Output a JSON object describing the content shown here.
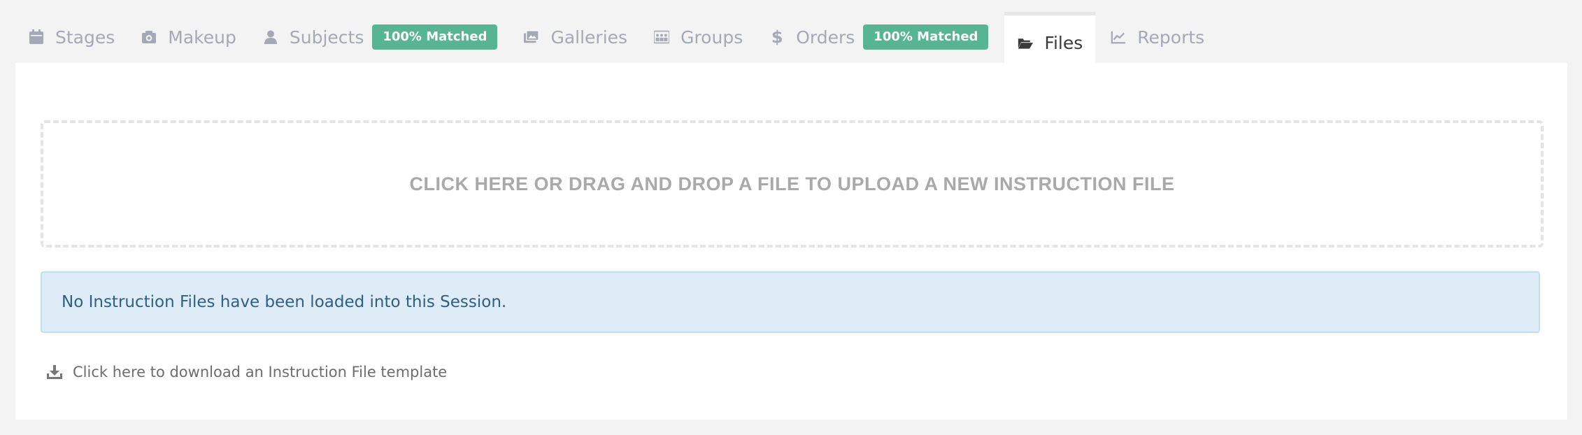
{
  "tabs": [
    {
      "label": "Stages",
      "icon": "calendar-icon"
    },
    {
      "label": "Makeup",
      "icon": "camera-icon"
    },
    {
      "label": "Subjects",
      "icon": "user-icon",
      "badge": "100% Matched"
    },
    {
      "label": "Galleries",
      "icon": "image-icon"
    },
    {
      "label": "Groups",
      "icon": "group-icon"
    },
    {
      "label": "Orders",
      "icon": "dollar-icon",
      "badge": "100% Matched"
    },
    {
      "label": "Files",
      "icon": "folder-open-icon",
      "active": true
    },
    {
      "label": "Reports",
      "icon": "chart-line-icon"
    }
  ],
  "upload": {
    "text": "CLICK HERE OR DRAG AND DROP A FILE TO UPLOAD A NEW INSTRUCTION FILE"
  },
  "alert": {
    "text": "No Instruction Files have been loaded into this Session."
  },
  "download": {
    "text": "Click here to download an Instruction File template",
    "icon": "download-icon"
  },
  "colors": {
    "badge": "#58b593",
    "tab_inactive": "#a4a9b7",
    "tab_active": "#3a3a3a",
    "alert_bg": "#deecf7",
    "alert_text": "#2f5f82"
  }
}
